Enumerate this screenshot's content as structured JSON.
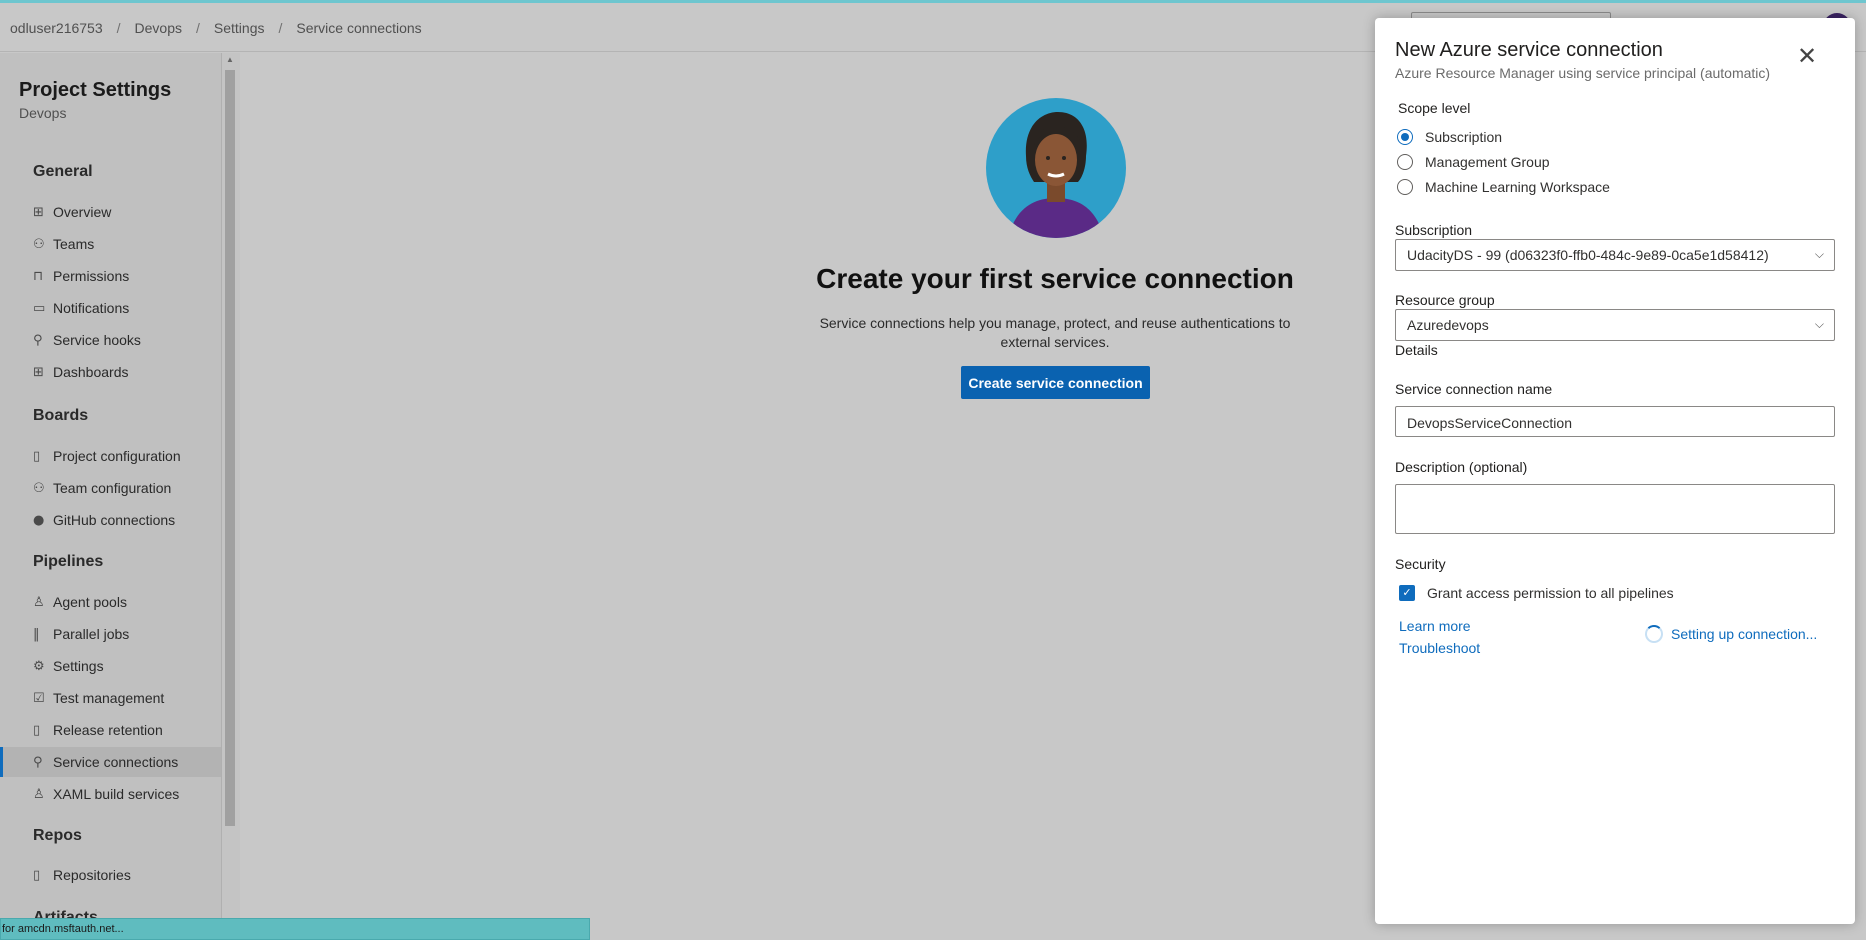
{
  "breadcrumb": [
    "odluser216753",
    "Devops",
    "Settings",
    "Service connections"
  ],
  "sidebar": {
    "title": "Project Settings",
    "subtitle": "Devops",
    "sections": {
      "general": "General",
      "boards": "Boards",
      "pipelines": "Pipelines",
      "repos": "Repos",
      "artifacts": "Artifacts"
    },
    "items": {
      "overview": "Overview",
      "teams": "Teams",
      "permissions": "Permissions",
      "notifications": "Notifications",
      "service_hooks": "Service hooks",
      "dashboards": "Dashboards",
      "project_configuration": "Project configuration",
      "team_configuration": "Team configuration",
      "github_connections": "GitHub connections",
      "agent_pools": "Agent pools",
      "parallel_jobs": "Parallel jobs",
      "settings": "Settings",
      "test_management": "Test management",
      "release_retention": "Release retention",
      "service_connections": "Service connections",
      "xaml_build_services": "XAML build services",
      "repositories": "Repositories"
    },
    "active_item": "Service connections"
  },
  "main": {
    "heading": "Create your first service connection",
    "description": "Service connections help you manage, protect, and reuse authentications to external services.",
    "button_label": "Create service connection"
  },
  "status_bar": "for amcdn.msftauth.net...",
  "panel": {
    "title": "New Azure service connection",
    "subtitle": "Azure Resource Manager using service principal (automatic)",
    "scope_label": "Scope level",
    "scope_options": [
      "Subscription",
      "Management Group",
      "Machine Learning Workspace"
    ],
    "scope_selected": "Subscription",
    "subscription_label": "Subscription",
    "subscription_value": "UdacityDS - 99 (d06323f0-ffb0-484c-9e89-0ca5e1d58412)",
    "resource_group_label": "Resource group",
    "resource_group_value": "Azuredevops",
    "details_label": "Details",
    "name_label": "Service connection name",
    "name_value": "DevopsServiceConnection",
    "description_label": "Description (optional)",
    "description_value": "",
    "security_label": "Security",
    "grant_access_label": "Grant access permission to all pipelines",
    "grant_access_checked": true,
    "learn_more": "Learn more",
    "troubleshoot": "Troubleshoot",
    "status_text": "Setting up connection..."
  },
  "colors": {
    "accent": "#0f6cbd",
    "primary_button": "#0a62b0",
    "overlay_bg": "#c8c8c8"
  }
}
